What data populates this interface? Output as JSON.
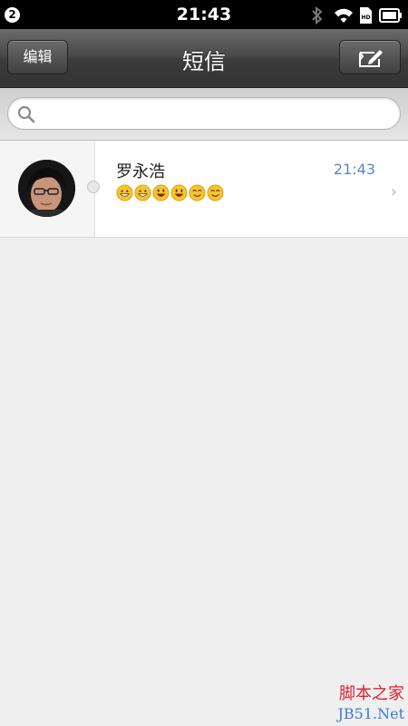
{
  "status_bar": {
    "notification_count": "2",
    "time": "21:43",
    "icons": [
      "bluetooth-icon",
      "wifi-icon",
      "sim-hd-icon",
      "battery-icon"
    ]
  },
  "nav": {
    "edit_label": "编辑",
    "title": "短信",
    "compose_icon": "compose-icon"
  },
  "search": {
    "placeholder": "",
    "icon": "search-icon"
  },
  "conversations": [
    {
      "name": "罗永浩",
      "time": "21:43",
      "preview_emojis": [
        "grinning-face",
        "grinning-face",
        "smiling-face-open-mouth",
        "smiling-face-open-mouth",
        "smiling-face",
        "smiling-face"
      ]
    }
  ],
  "watermark": {
    "line1": "脚本之家",
    "line2": "JB51.Net"
  },
  "colors": {
    "nav_bg": "#444444",
    "time_accent": "#5b86c0",
    "background": "#efefef"
  }
}
